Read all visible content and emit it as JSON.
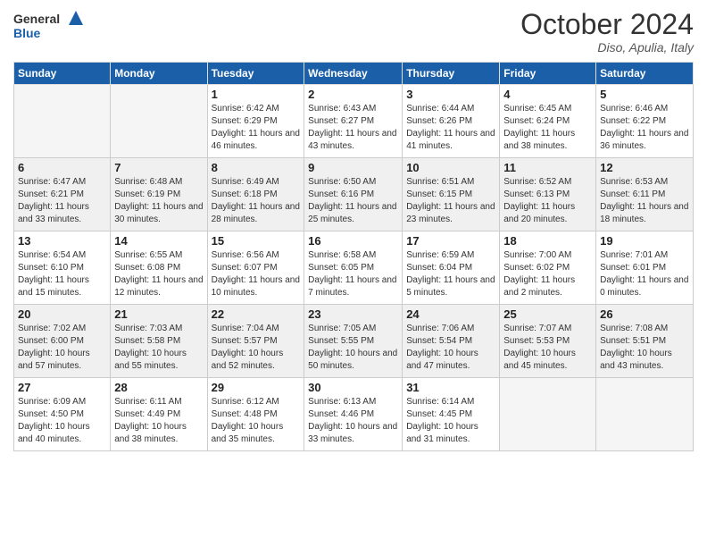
{
  "logo": {
    "line1": "General",
    "line2": "Blue"
  },
  "title": "October 2024",
  "location": "Diso, Apulia, Italy",
  "days_of_week": [
    "Sunday",
    "Monday",
    "Tuesday",
    "Wednesday",
    "Thursday",
    "Friday",
    "Saturday"
  ],
  "weeks": [
    [
      {
        "day": "",
        "info": ""
      },
      {
        "day": "",
        "info": ""
      },
      {
        "day": "1",
        "info": "Sunrise: 6:42 AM\nSunset: 6:29 PM\nDaylight: 11 hours and 46 minutes."
      },
      {
        "day": "2",
        "info": "Sunrise: 6:43 AM\nSunset: 6:27 PM\nDaylight: 11 hours and 43 minutes."
      },
      {
        "day": "3",
        "info": "Sunrise: 6:44 AM\nSunset: 6:26 PM\nDaylight: 11 hours and 41 minutes."
      },
      {
        "day": "4",
        "info": "Sunrise: 6:45 AM\nSunset: 6:24 PM\nDaylight: 11 hours and 38 minutes."
      },
      {
        "day": "5",
        "info": "Sunrise: 6:46 AM\nSunset: 6:22 PM\nDaylight: 11 hours and 36 minutes."
      }
    ],
    [
      {
        "day": "6",
        "info": "Sunrise: 6:47 AM\nSunset: 6:21 PM\nDaylight: 11 hours and 33 minutes."
      },
      {
        "day": "7",
        "info": "Sunrise: 6:48 AM\nSunset: 6:19 PM\nDaylight: 11 hours and 30 minutes."
      },
      {
        "day": "8",
        "info": "Sunrise: 6:49 AM\nSunset: 6:18 PM\nDaylight: 11 hours and 28 minutes."
      },
      {
        "day": "9",
        "info": "Sunrise: 6:50 AM\nSunset: 6:16 PM\nDaylight: 11 hours and 25 minutes."
      },
      {
        "day": "10",
        "info": "Sunrise: 6:51 AM\nSunset: 6:15 PM\nDaylight: 11 hours and 23 minutes."
      },
      {
        "day": "11",
        "info": "Sunrise: 6:52 AM\nSunset: 6:13 PM\nDaylight: 11 hours and 20 minutes."
      },
      {
        "day": "12",
        "info": "Sunrise: 6:53 AM\nSunset: 6:11 PM\nDaylight: 11 hours and 18 minutes."
      }
    ],
    [
      {
        "day": "13",
        "info": "Sunrise: 6:54 AM\nSunset: 6:10 PM\nDaylight: 11 hours and 15 minutes."
      },
      {
        "day": "14",
        "info": "Sunrise: 6:55 AM\nSunset: 6:08 PM\nDaylight: 11 hours and 12 minutes."
      },
      {
        "day": "15",
        "info": "Sunrise: 6:56 AM\nSunset: 6:07 PM\nDaylight: 11 hours and 10 minutes."
      },
      {
        "day": "16",
        "info": "Sunrise: 6:58 AM\nSunset: 6:05 PM\nDaylight: 11 hours and 7 minutes."
      },
      {
        "day": "17",
        "info": "Sunrise: 6:59 AM\nSunset: 6:04 PM\nDaylight: 11 hours and 5 minutes."
      },
      {
        "day": "18",
        "info": "Sunrise: 7:00 AM\nSunset: 6:02 PM\nDaylight: 11 hours and 2 minutes."
      },
      {
        "day": "19",
        "info": "Sunrise: 7:01 AM\nSunset: 6:01 PM\nDaylight: 11 hours and 0 minutes."
      }
    ],
    [
      {
        "day": "20",
        "info": "Sunrise: 7:02 AM\nSunset: 6:00 PM\nDaylight: 10 hours and 57 minutes."
      },
      {
        "day": "21",
        "info": "Sunrise: 7:03 AM\nSunset: 5:58 PM\nDaylight: 10 hours and 55 minutes."
      },
      {
        "day": "22",
        "info": "Sunrise: 7:04 AM\nSunset: 5:57 PM\nDaylight: 10 hours and 52 minutes."
      },
      {
        "day": "23",
        "info": "Sunrise: 7:05 AM\nSunset: 5:55 PM\nDaylight: 10 hours and 50 minutes."
      },
      {
        "day": "24",
        "info": "Sunrise: 7:06 AM\nSunset: 5:54 PM\nDaylight: 10 hours and 47 minutes."
      },
      {
        "day": "25",
        "info": "Sunrise: 7:07 AM\nSunset: 5:53 PM\nDaylight: 10 hours and 45 minutes."
      },
      {
        "day": "26",
        "info": "Sunrise: 7:08 AM\nSunset: 5:51 PM\nDaylight: 10 hours and 43 minutes."
      }
    ],
    [
      {
        "day": "27",
        "info": "Sunrise: 6:09 AM\nSunset: 4:50 PM\nDaylight: 10 hours and 40 minutes."
      },
      {
        "day": "28",
        "info": "Sunrise: 6:11 AM\nSunset: 4:49 PM\nDaylight: 10 hours and 38 minutes."
      },
      {
        "day": "29",
        "info": "Sunrise: 6:12 AM\nSunset: 4:48 PM\nDaylight: 10 hours and 35 minutes."
      },
      {
        "day": "30",
        "info": "Sunrise: 6:13 AM\nSunset: 4:46 PM\nDaylight: 10 hours and 33 minutes."
      },
      {
        "day": "31",
        "info": "Sunrise: 6:14 AM\nSunset: 4:45 PM\nDaylight: 10 hours and 31 minutes."
      },
      {
        "day": "",
        "info": ""
      },
      {
        "day": "",
        "info": ""
      }
    ]
  ]
}
